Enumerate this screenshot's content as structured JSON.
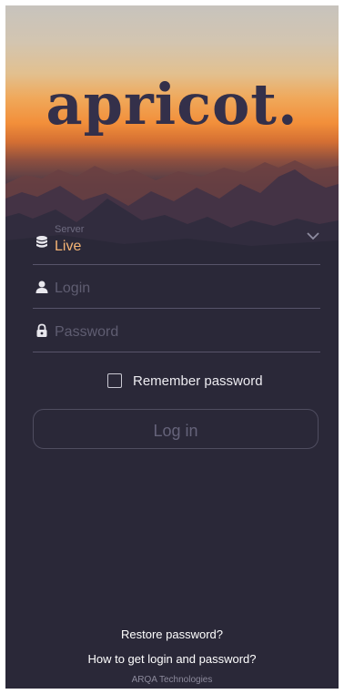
{
  "brand": {
    "logo_text": "apricot."
  },
  "form": {
    "server": {
      "caption": "Server",
      "value": "Live",
      "icon": "database-icon"
    },
    "login": {
      "placeholder": "Login",
      "icon": "user-icon"
    },
    "password": {
      "placeholder": "Password",
      "icon": "lock-icon"
    },
    "remember_label": "Remember password",
    "remember_checked": false,
    "login_button": "Log in"
  },
  "footer": {
    "restore_password": "Restore password?",
    "how_to_get": "How to get login and password?",
    "company": "ARQA Technologies"
  },
  "colors": {
    "background": "#2a2838",
    "accent": "#f5b474",
    "brand_text": "#34304a"
  }
}
